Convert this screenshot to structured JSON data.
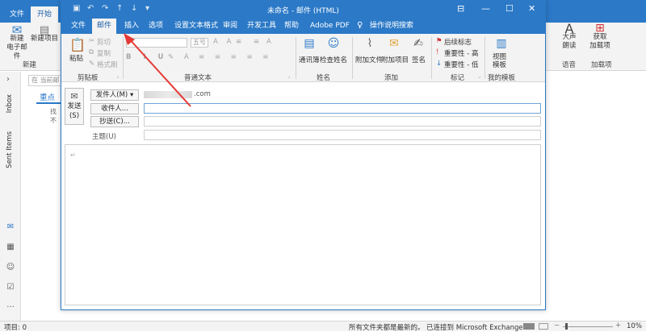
{
  "background": {
    "tabs": [
      "文件",
      "开始"
    ],
    "ribbon_new_email": "新建\n电子邮件",
    "ribbon_new_items": "新建项目",
    "group_new": "新建",
    "right_read_aloud": "大声\n朗读",
    "right_addins": "获取\n加载项",
    "group_voice": "语音",
    "group_addins": "加载项",
    "search_placeholder": "在 当前邮",
    "focused_tab": "重点",
    "find_hint": "找不",
    "sidebar_inbox": "Inbox",
    "sidebar_sent": "Sent Items",
    "status_items": "项目: 0",
    "status_folders": "所有文件夹都是最新的。",
    "status_connection": "已连接到 Microsoft Exchange",
    "zoom": "10%"
  },
  "window": {
    "title": "未命名 - 邮件 (HTML)",
    "tabs": [
      "文件",
      "邮件",
      "插入",
      "选项",
      "设置文本格式",
      "审阅",
      "开发工具",
      "帮助",
      "Adobe PDF",
      "操作说明搜索"
    ],
    "active_tab": "邮件",
    "ribbon": {
      "paste": "粘贴",
      "cut": "剪切",
      "copy": "复制",
      "format_painter": "格式刷",
      "group_clipboard": "剪贴板",
      "font_size": "五号",
      "group_basic_text": "普通文本",
      "address_book": "通讯簿",
      "check_names": "检查姓名",
      "group_names": "姓名",
      "attach_file": "附加文件",
      "attach_item": "附加项目",
      "signature": "签名",
      "group_include": "添加",
      "follow_up": "后续标志",
      "high_importance": "重要性 - 高",
      "low_importance": "重要性 - 低",
      "group_tags": "标记",
      "view_templates": "视图\n模板",
      "group_my_templates": "我的模板"
    },
    "compose": {
      "send": "发送\n(S)",
      "from_button": "发件人(M)",
      "from_value": ".com",
      "to_button": "收件人...",
      "cc_button": "抄送(C)...",
      "subject_label": "主题(U)",
      "to_value": "",
      "cc_value": "",
      "subject_value": ""
    }
  },
  "colors": {
    "accent": "#2b79c7",
    "arrow": "#e53935"
  }
}
